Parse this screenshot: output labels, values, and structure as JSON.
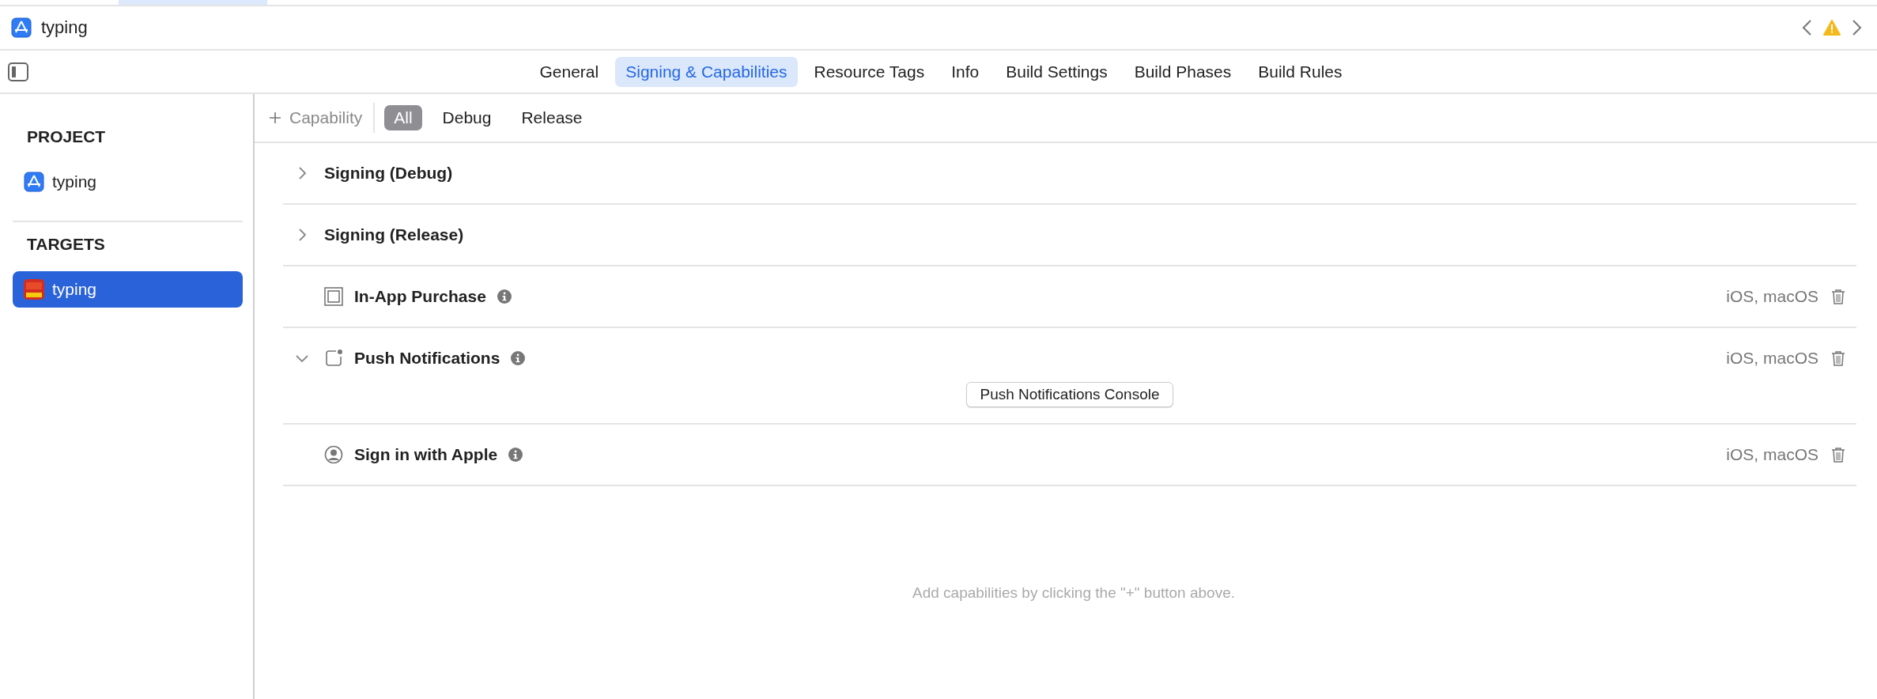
{
  "title_bar": {
    "project": "typing"
  },
  "editor_tabs": [
    {
      "label": "General",
      "selected": false
    },
    {
      "label": "Signing & Capabilities",
      "selected": true
    },
    {
      "label": "Resource Tags",
      "selected": false
    },
    {
      "label": "Info",
      "selected": false
    },
    {
      "label": "Build Settings",
      "selected": false
    },
    {
      "label": "Build Phases",
      "selected": false
    },
    {
      "label": "Build Rules",
      "selected": false
    }
  ],
  "sidebar": [
    {
      "heading": "PROJECT",
      "items": [
        {
          "label": "typing",
          "kind": "project",
          "selected": false
        }
      ]
    },
    {
      "heading": "TARGETS",
      "items": [
        {
          "label": "typing",
          "kind": "target",
          "selected": true
        }
      ]
    }
  ],
  "filter_bar": {
    "add_label": "Capability",
    "options": [
      {
        "label": "All",
        "selected": true
      },
      {
        "label": "Debug",
        "selected": false
      },
      {
        "label": "Release",
        "selected": false
      }
    ]
  },
  "capabilities": [
    {
      "kind": "signing",
      "title": "Signing (Debug)",
      "expanded": false
    },
    {
      "kind": "signing",
      "title": "Signing (Release)",
      "expanded": false
    },
    {
      "kind": "purchase",
      "title": "In-App Purchase",
      "platforms": "iOS, macOS"
    },
    {
      "kind": "notification",
      "title": "Push Notifications",
      "expanded": true,
      "platforms": "iOS, macOS",
      "button": "Push Notifications Console"
    },
    {
      "kind": "account",
      "title": "Sign in with Apple",
      "platforms": "iOS, macOS"
    }
  ],
  "empty_hint": "Add capabilities by clicking the \"+\" button above."
}
